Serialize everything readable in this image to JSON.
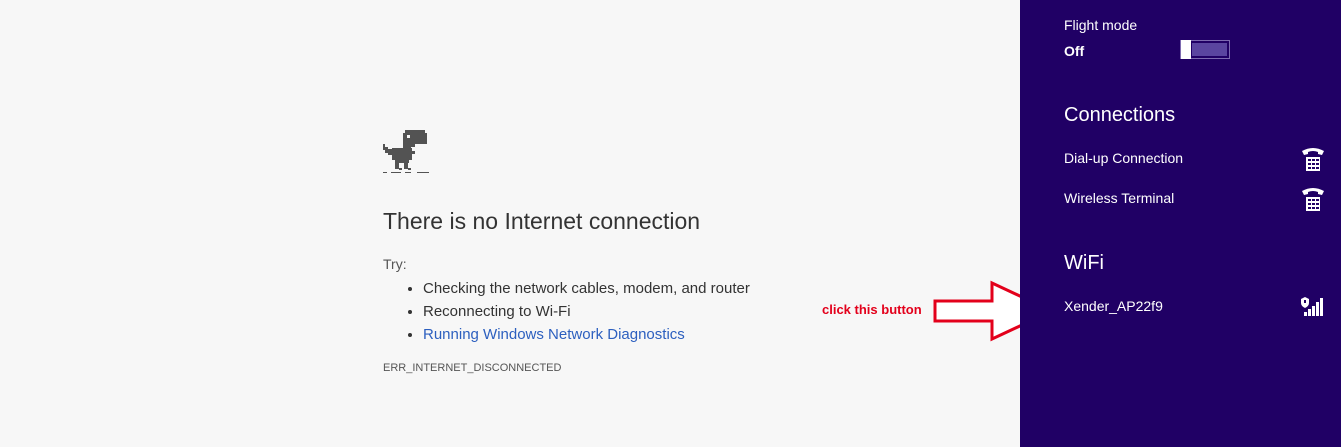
{
  "error_page": {
    "title": "There is no Internet connection",
    "try_label": "Try:",
    "suggestions": [
      "Checking the network cables, modem, and router",
      "Reconnecting to Wi-Fi",
      "Running Windows Network Diagnostics"
    ],
    "error_code": "ERR_INTERNET_DISCONNECTED",
    "icon": "dino-icon"
  },
  "annotation": {
    "text": "click this button",
    "color": "#e3001b",
    "icon": "arrow-right-icon"
  },
  "network_panel": {
    "background": "#200065",
    "flight_mode": {
      "label": "Flight mode",
      "state": "Off"
    },
    "connections": {
      "heading": "Connections",
      "items": [
        {
          "label": "Dial-up Connection",
          "icon": "telephone-icon"
        },
        {
          "label": "Wireless Terminal",
          "icon": "telephone-icon"
        }
      ]
    },
    "wifi": {
      "heading": "WiFi",
      "items": [
        {
          "label": "Xender_AP22f9",
          "icon": "wifi-signal-secured-icon"
        }
      ]
    }
  }
}
